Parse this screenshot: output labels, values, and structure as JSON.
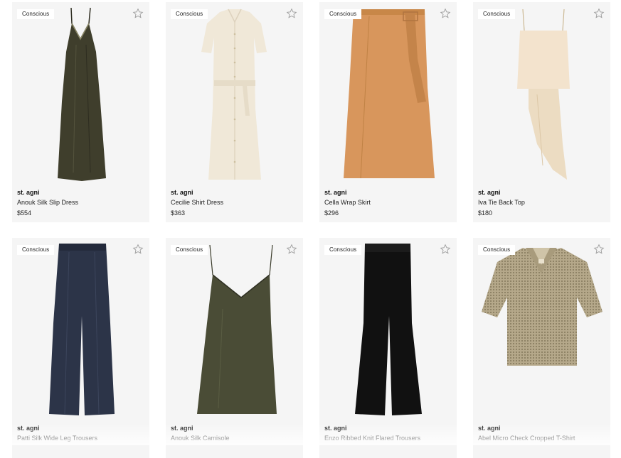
{
  "products": [
    {
      "badge": "Conscious",
      "brand": "st. agni",
      "name": "Anouk Silk Slip Dress",
      "price": "$554",
      "icon": "star-outline-icon",
      "color": "#3f3e2c"
    },
    {
      "badge": "Conscious",
      "brand": "st. agni",
      "name": "Cecilie Shirt Dress",
      "price": "$363",
      "icon": "star-outline-icon",
      "color": "#f0e8d8"
    },
    {
      "badge": "Conscious",
      "brand": "st. agni",
      "name": "Cella Wrap Skirt",
      "price": "$296",
      "icon": "star-outline-icon",
      "color": "#d8965c"
    },
    {
      "badge": "Conscious",
      "brand": "st. agni",
      "name": "Iva Tie Back Top",
      "price": "$180",
      "icon": "star-outline-icon",
      "color": "#f3e3cd"
    },
    {
      "badge": "Conscious",
      "brand": "st. agni",
      "name": "Patti Silk Wide Leg Trousers",
      "icon": "star-outline-icon",
      "color": "#2c3448"
    },
    {
      "badge": "Conscious",
      "brand": "st. agni",
      "name": "Anouk Silk Camisole",
      "icon": "star-outline-icon",
      "color": "#4a4c36"
    },
    {
      "badge": "Conscious",
      "brand": "st. agni",
      "name": "Enzo Ribbed Knit Flared Trousers",
      "icon": "star-outline-icon",
      "color": "#111111"
    },
    {
      "badge": "Conscious",
      "brand": "st. agni",
      "name": "Abel Micro Check Cropped T-Shirt",
      "icon": "star-outline-icon",
      "color": "#b5a88a"
    }
  ]
}
